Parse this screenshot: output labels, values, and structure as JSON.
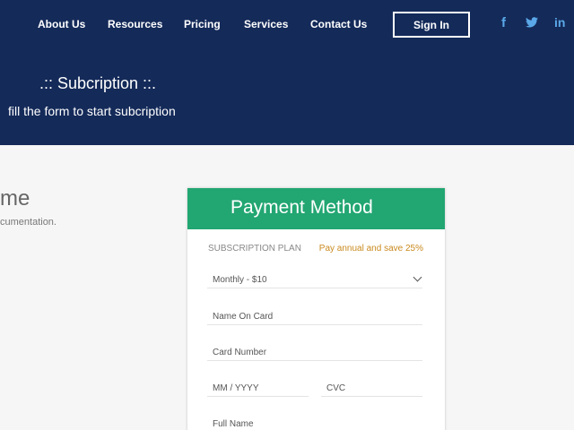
{
  "nav": {
    "items": [
      "About Us",
      "Resources",
      "Pricing",
      "Services",
      "Contact Us"
    ],
    "sign_in": "Sign In",
    "social": [
      "f",
      "t",
      "in"
    ]
  },
  "hero": {
    "title": ".:: Subcription ::.",
    "subtitle": "fill the form to start subcription"
  },
  "body": {
    "heading_fragment": "me",
    "sub_fragment": "cumentation."
  },
  "card": {
    "title": "Payment Method",
    "plan_label": "SUBSCRIPTION PLAN",
    "promo": "Pay annual and save 25%",
    "plan_value": "Monthly - $10",
    "fields": {
      "name_on_card": "Name On Card",
      "card_number": "Card Number",
      "expiry": "MM / YYYY",
      "cvc": "CVC",
      "full_name": "Full Name"
    }
  },
  "colors": {
    "header": "#142a59",
    "accent": "#22a672",
    "promo": "#c98a1e"
  }
}
